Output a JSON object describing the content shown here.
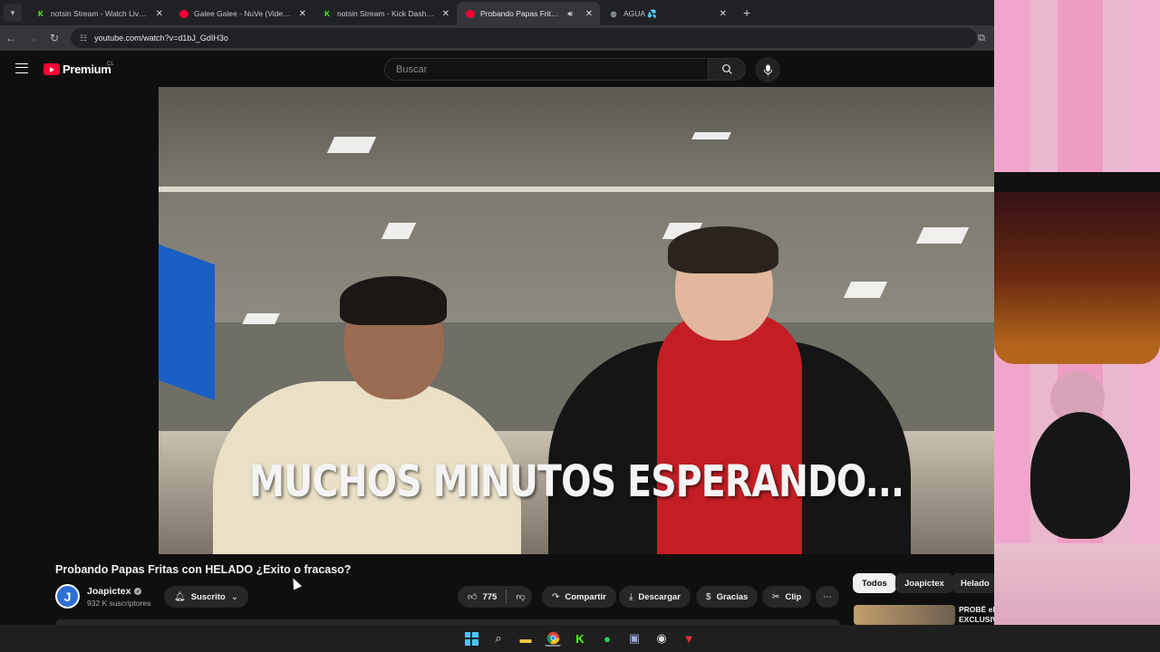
{
  "browser": {
    "tabs": [
      {
        "title": "notsin Stream - Watch Live on",
        "favicon": "kick-icon",
        "active": false
      },
      {
        "title": "Galee Galee - NuVe (Video Ofi",
        "favicon": "youtube-icon",
        "active": false
      },
      {
        "title": "notsin Stream - Kick Dashboard",
        "favicon": "kick-icon",
        "active": false
      },
      {
        "title": "Probando Papas Fritas con",
        "favicon": "youtube-icon",
        "active": true
      },
      {
        "title": "AGUA 💦",
        "favicon": "globe-icon",
        "active": false
      }
    ],
    "url": "youtube.com/watch?v=d1bJ_GdIH3o"
  },
  "youtube": {
    "logo_text": "Premium",
    "country": "CL",
    "search_placeholder": "Buscar"
  },
  "video": {
    "caption": "MUCHOS MINUTOS ESPERANDO...",
    "title": "Probando Papas Fritas con HELADO ¿Exito o fracaso?",
    "channel": {
      "avatar_letter": "J",
      "name": "Joapictex",
      "subscribers": "932 K suscriptores"
    },
    "subscribe_label": "Suscrito",
    "likes": "775",
    "actions": {
      "share": "Compartir",
      "download": "Descargar",
      "thanks": "Gracias",
      "clip": "Clip"
    }
  },
  "recommendations": {
    "chips": [
      "Todos",
      "Joapictex",
      "Helado"
    ],
    "first_item_title": "PROBÉ el EXCLUSIV"
  },
  "colors": {
    "youtube_red": "#ff0033",
    "kick_green": "#53fc18",
    "background": "#0f0f0f"
  }
}
